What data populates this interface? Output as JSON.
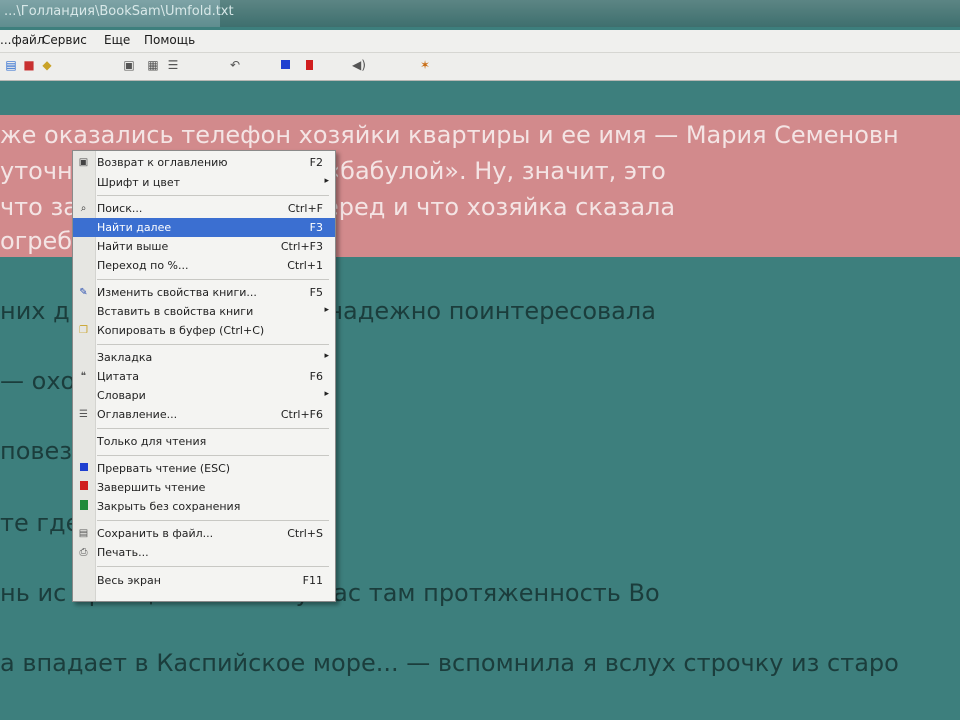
{
  "window": {
    "title": "...\\Голландия\\BookSam\\Umfold.txt"
  },
  "menubar": {
    "items": [
      "...файл",
      "Сервис",
      "Еще",
      "Помощь"
    ]
  },
  "toolbar": {
    "icons": [
      "open-icon",
      "save-icon",
      "bookmark-icon",
      "page-icon",
      "doc-icon",
      "list-icon",
      "back-icon",
      "color-blue-icon",
      "color-red-icon",
      "speaker-icon",
      "pin-icon"
    ],
    "accent_blue": "#1e3fd0",
    "accent_red": "#d01e1e"
  },
  "content": {
    "bg_color": "#3d7f7d",
    "highlight_color": "#d28a8c",
    "lines": [
      "же оказались телефон хозяйки квартиры и ее имя — Мария Семеновн",
      "уточн                                         и. Атлет назвал ее «бабулой». Ну, значит, это",
      "что за                                          у за три месяца вперед и что хозяйка сказала",
      "огреб",
      "них д                                   наете? — почти безнадежно поинтересовала",
      "— охо                                   .",
      "повез",
      "те где                                  он",
      "нь ис                                    ормация. Какова у нас там протяженность Во",
      "а впадает в Каспийское море... — вспомнила я вслух строчку из старо"
    ]
  },
  "context_menu": {
    "items": [
      {
        "icon": "return-icon",
        "label": "Возврат к оглавлению",
        "shortcut": "F2",
        "arrow": ""
      },
      {
        "icon": "",
        "label": "Шрифт и цвет",
        "shortcut": "",
        "arrow": "▸"
      },
      {
        "icon": "search-icon",
        "label": "Поиск...",
        "shortcut": "Ctrl+F",
        "arrow": ""
      },
      {
        "icon": "",
        "label": "Найти далее",
        "shortcut": "F3",
        "arrow": ""
      },
      {
        "icon": "",
        "label": "Найти выше",
        "shortcut": "Ctrl+F3",
        "arrow": ""
      },
      {
        "icon": "",
        "label": "Переход по %...",
        "shortcut": "Ctrl+1",
        "arrow": ""
      },
      {
        "icon": "edit-icon",
        "label": "Изменить свойства книги...",
        "shortcut": "F5",
        "arrow": ""
      },
      {
        "icon": "",
        "label": "Вставить в свойства книги",
        "shortcut": "",
        "arrow": "▸"
      },
      {
        "icon": "copy-icon",
        "label": "Копировать в буфер (Ctrl+C)",
        "shortcut": "",
        "arrow": ""
      },
      {
        "icon": "",
        "label": "Закладка",
        "shortcut": "",
        "arrow": "▸"
      },
      {
        "icon": "quote-icon",
        "label": "Цитата",
        "shortcut": "F6",
        "arrow": ""
      },
      {
        "icon": "",
        "label": "Словари",
        "shortcut": "",
        "arrow": "▸"
      },
      {
        "icon": "toc-icon",
        "label": "Оглавление...",
        "shortcut": "Ctrl+F6",
        "arrow": ""
      },
      {
        "icon": "",
        "label": "Только для чтения",
        "shortcut": "",
        "arrow": ""
      },
      {
        "icon": "stop-blue-icon",
        "label": "Прервать чтение (ESC)",
        "shortcut": "",
        "arrow": ""
      },
      {
        "icon": "stop-red-icon",
        "label": "Завершить чтение",
        "shortcut": "",
        "arrow": ""
      },
      {
        "icon": "close-green-icon",
        "label": "Закрыть без сохранения",
        "shortcut": "",
        "arrow": ""
      },
      {
        "icon": "save-icon",
        "label": "Сохранить в файл...",
        "shortcut": "Ctrl+S",
        "arrow": ""
      },
      {
        "icon": "print-icon",
        "label": "Печать...",
        "shortcut": "",
        "arrow": ""
      },
      {
        "icon": "",
        "label": "Весь экран",
        "shortcut": "F11",
        "arrow": ""
      }
    ],
    "selected_index": 3
  }
}
